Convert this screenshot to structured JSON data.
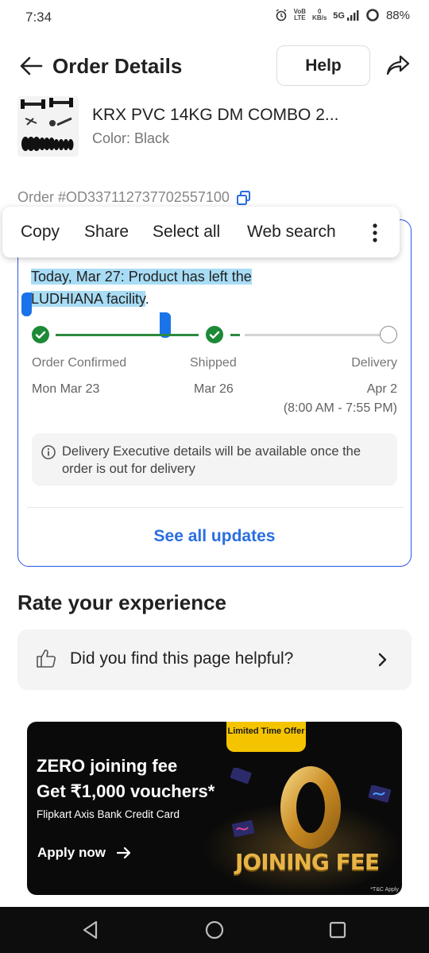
{
  "status_bar": {
    "time": "7:34",
    "lte_label_top": "VoB",
    "lte_label_bottom": "LTE",
    "speed_top": "0",
    "speed_bottom": "KB/s",
    "network": "5G",
    "battery": "88%"
  },
  "header": {
    "title": "Order Details",
    "help_label": "Help"
  },
  "product": {
    "name": "KRX PVC 14KG DM COMBO 2...",
    "color": "Color: Black"
  },
  "order": {
    "id": "Order #OD337112737702557100"
  },
  "context_menu": {
    "items": [
      "Copy",
      "Share",
      "Select all",
      "Web search"
    ]
  },
  "tracking": {
    "status_line1_highlighted": "Today, Mar 27: Product has left the",
    "status_line2_highlighted": "LUDHIANA facility",
    "status_line2_tail": ".",
    "stages": [
      {
        "label": "Order Confirmed",
        "date": "Mon Mar 23",
        "done": true
      },
      {
        "label": "Shipped",
        "date": "Mar 26",
        "done": true
      },
      {
        "label": "Delivery",
        "date": "Apr 2",
        "time": "(8:00 AM - 7:55 PM)",
        "done": false
      }
    ],
    "info_text": "Delivery Executive details will be available once the order is out for delivery",
    "see_all": "See all updates"
  },
  "rate": {
    "title": "Rate your experience",
    "question": "Did you find this page helpful?"
  },
  "banner": {
    "tag": "Limited Time Offer",
    "headline_line1": "ZERO joining fee",
    "headline_line2": "Get ₹1,000 vouchers*",
    "subtitle": "Flipkart Axis Bank Credit Card",
    "cta": "Apply now",
    "big_zero": "0",
    "joining_fee": "JOINING FEE",
    "tc": "*T&C Apply"
  },
  "colors": {
    "accent_blue": "#2a6ee0",
    "card_border": "#2a55e5",
    "success_green": "#1c8a36",
    "highlight": "#a8dcf5",
    "banner_gold": "#f4c400"
  }
}
